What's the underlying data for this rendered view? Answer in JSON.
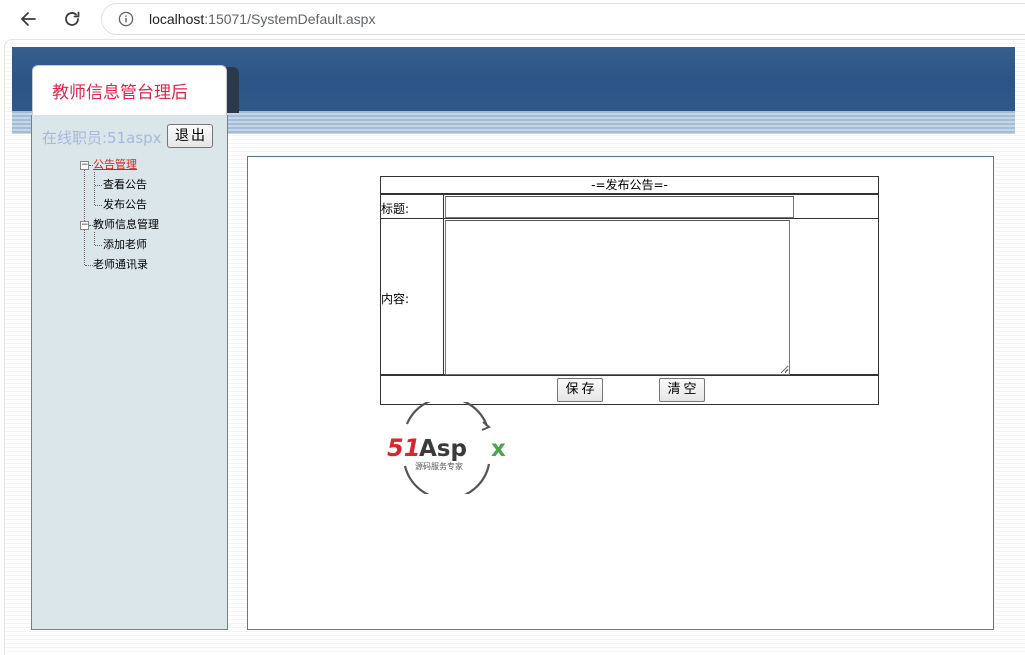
{
  "browser": {
    "url_host": "localhost",
    "url_rest": ":15071/SystemDefault.aspx"
  },
  "header": {
    "title": "教师信息管台理后"
  },
  "sidebar": {
    "online_user": "在线职员:51aspx",
    "logout_label": "退出",
    "tree": {
      "notice_group": "公告管理",
      "view_notice": "查看公告",
      "publish_notice": "发布公告",
      "teacher_group": "教师信息管理",
      "add_teacher": "添加老师",
      "teacher_contacts": "老师通讯录"
    }
  },
  "form": {
    "heading": "-=发布公告=-",
    "title_label": "标题:",
    "title_value": "",
    "content_label": "内容:",
    "content_value": "",
    "save_label": "保存",
    "clear_label": "清空"
  },
  "logo": {
    "brand_red": "51",
    "brand_dark": "Asp",
    "brand_green": "x",
    "tagline": "源码服务专家"
  },
  "colors": {
    "banner": "#2c5485",
    "title_red": "#e0244a",
    "sidebar_bg": "#dae6ea",
    "active_link": "#d2231d"
  }
}
